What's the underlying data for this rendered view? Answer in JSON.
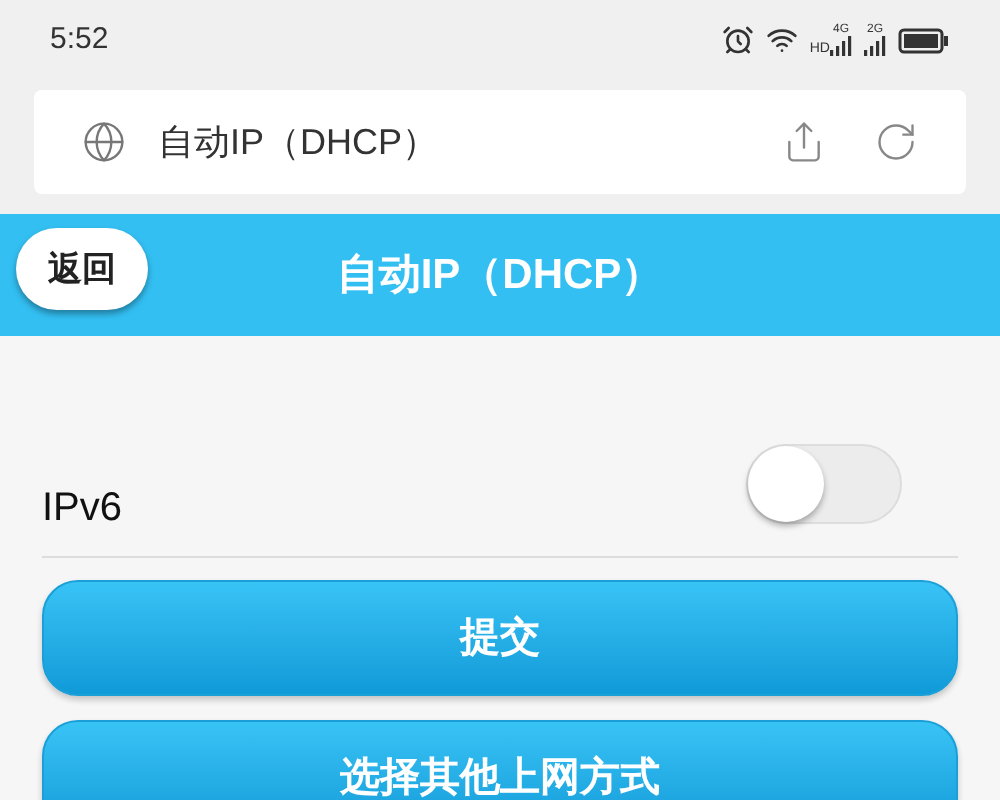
{
  "status_bar": {
    "time": "5:52",
    "hd": "HD",
    "network_1": "4G",
    "network_2": "2G"
  },
  "browser_bar": {
    "url": "自动IP（DHCP）"
  },
  "header": {
    "back": "返回",
    "title": "自动IP（DHCP）"
  },
  "ipv6": {
    "label": "IPv6",
    "on": false
  },
  "buttons": [
    "提交",
    "选择其他上网方式"
  ]
}
